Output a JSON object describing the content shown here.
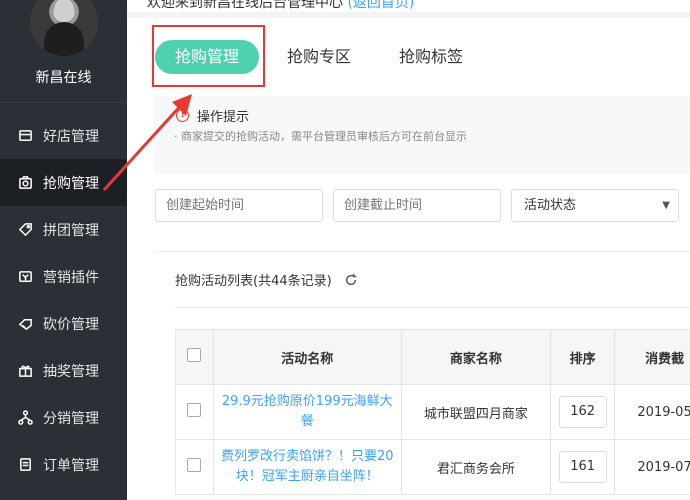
{
  "sidebar": {
    "shop_name": "新昌在线",
    "items": [
      {
        "label": "好店管理",
        "icon": "shop-icon",
        "active": false
      },
      {
        "label": "抢购管理",
        "icon": "flash-sale-icon",
        "active": true
      },
      {
        "label": "拼团管理",
        "icon": "tag-icon",
        "active": false
      },
      {
        "label": "营销插件",
        "icon": "plugin-icon",
        "active": false
      },
      {
        "label": "砍价管理",
        "icon": "bargain-icon",
        "active": false
      },
      {
        "label": "抽奖管理",
        "icon": "gift-icon",
        "active": false
      },
      {
        "label": "分销管理",
        "icon": "distribution-icon",
        "active": false
      },
      {
        "label": "订单管理",
        "icon": "order-icon",
        "active": false
      }
    ]
  },
  "topbar": {
    "text": "欢迎来到新昌在线后台管理中心",
    "link": "(返回首页)"
  },
  "tabs": [
    {
      "label": "抢购管理",
      "active": true
    },
    {
      "label": "抢购专区",
      "active": false
    },
    {
      "label": "抢购标签",
      "active": false
    }
  ],
  "tip": {
    "title": "操作提示",
    "desc": "· 商家提交的抢购活动，需平台管理员审核后方可在前台显示"
  },
  "filters": {
    "start_placeholder": "创建起始时间",
    "end_placeholder": "创建截止时间",
    "status_label": "活动状态"
  },
  "list": {
    "title": "抢购活动列表(共44条记录)",
    "columns": [
      "活动名称",
      "商家名称",
      "排序",
      "消费截"
    ],
    "rows": [
      {
        "name": "29.9元抢购原价199元海鲜大餐",
        "merchant": "城市联盟四月商家",
        "sort": "162",
        "date": "2019-05"
      },
      {
        "name": "费列罗改行卖馅饼？！只要20块！冠军主厨亲自坐阵！",
        "merchant": "君汇商务会所",
        "sort": "161",
        "date": "2019-07"
      }
    ]
  },
  "colors": {
    "accent": "#4fd1b0",
    "sidebar_bg": "#2b2f36",
    "link": "#3aa0ff",
    "highlight": "#e53935"
  }
}
